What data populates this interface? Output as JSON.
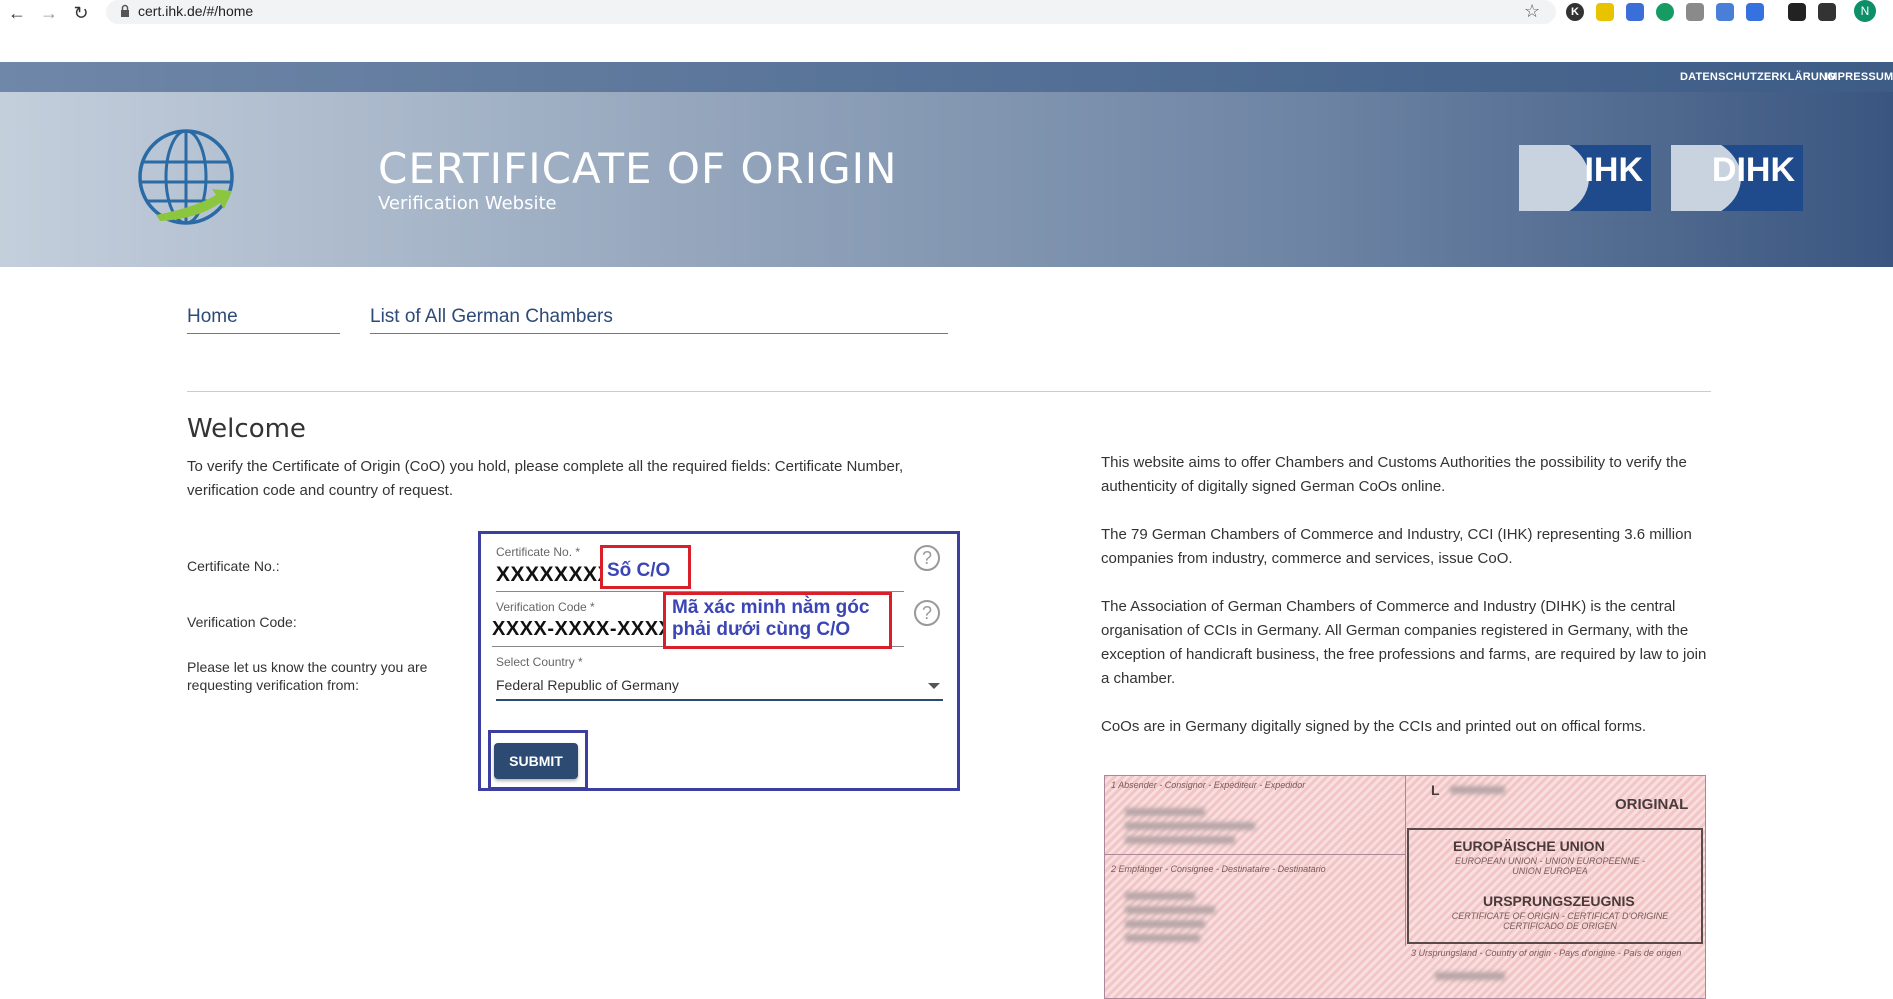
{
  "browser": {
    "url": "cert.ihk.de/#/home",
    "avatar_letter": "N"
  },
  "header": {
    "links": [
      "DATENSCHUTZERKLÄRUNG",
      "IMPRESSUM"
    ],
    "title": "CERTIFICATE OF ORIGIN",
    "subtitle": "Verification Website",
    "logo_left": "IHK",
    "logo_right": "DIHK",
    "brand_color": "#1f4a8c"
  },
  "nav": {
    "tabs": [
      {
        "label": "Home"
      },
      {
        "label": "List of All German Chambers"
      }
    ]
  },
  "welcome": {
    "heading": "Welcome",
    "intro": "To verify the Certificate of Origin (CoO) you hold, please complete all the required fields: Certificate Number, verification code and country of request."
  },
  "form": {
    "row_labels": {
      "certificate": "Certificate No.:",
      "verification": "Verification Code:",
      "country": "Please let us know the country you are requesting verification from:"
    },
    "certificate": {
      "label": "Certificate No. *",
      "value": "XXXXXXXX",
      "annotation": "Số C/O"
    },
    "verification": {
      "label": "Verification Code *",
      "value": "XXXX-XXXX-XXXX",
      "annotation": "Mã xác minh nằm góc phải dưới cùng C/O"
    },
    "country": {
      "label": "Select Country *",
      "value": "Federal Republic of Germany"
    },
    "submit_label": "SUBMIT"
  },
  "info": {
    "paragraphs": [
      "This website aims to offer Chambers and Customs Authorities the possibility to verify the authenticity of digitally signed German CoOs online.",
      "The 79 German Chambers of Commerce and Industry, CCI (IHK) representing 3.6 million companies from industry, commerce and services, issue CoO.",
      "The Association of German Chambers of Commerce and Industry (DIHK) is the central organisation of CCIs in Germany. All German companies registered in Germany, with the exception of handicraft business, the free professions and farms, are required by law to join a chamber.",
      "CoOs are in Germany digitally signed by the CCIs and printed out on offical forms."
    ]
  },
  "certificate_image": {
    "field1": "1 Absender - Consignor - Expéditeur - Expedidor",
    "field2": "2 Empfänger - Consignee - Destinataire - Destinatario",
    "field3": "3 Ursprungsland - Country of origin - Pays d'origine - País de origen",
    "letter": "L",
    "original": "ORIGINAL",
    "eu_title": "EUROPÄISCHE UNION",
    "eu_sub": "EUROPEAN UNION - UNION EUROPEENNE - UNION EUROPEA",
    "uz_title": "URSPRUNGSZEUGNIS",
    "uz_sub": "CERTIFICATE OF ORIGIN - CERTIFICAT D'ORIGINE CERTIFICADO DE ORIGEN"
  }
}
